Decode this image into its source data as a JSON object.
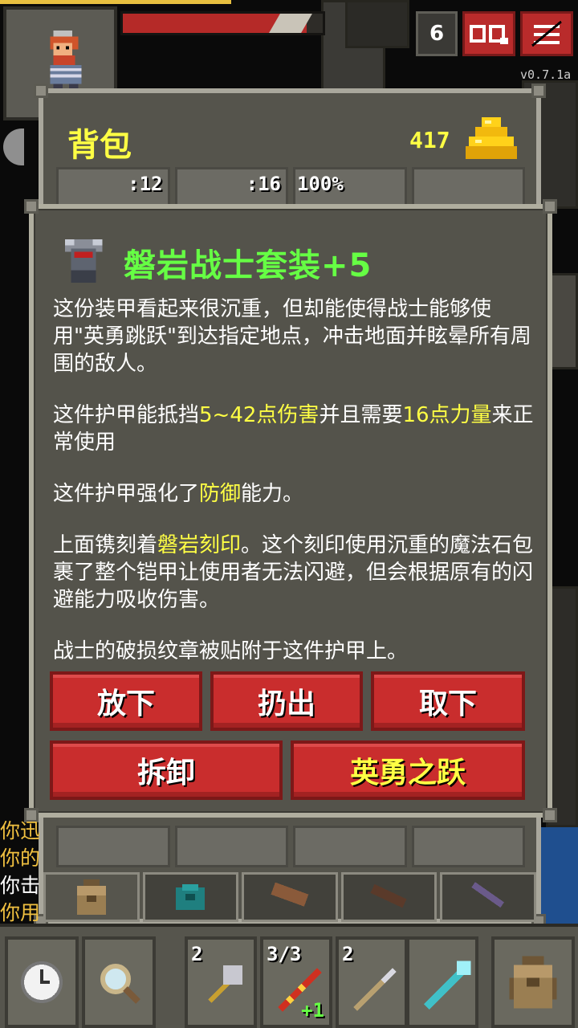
{
  "status": {
    "hp_fraction": 0.92,
    "xp_fraction": 0.4,
    "depth": "6",
    "version": "v0.7.1a"
  },
  "backpack": {
    "title": "背包",
    "gold": "417",
    "slot_labels": [
      ":12",
      ":16",
      "100%"
    ]
  },
  "item": {
    "name": "磐岩战士套装+5",
    "paragraphs": [
      [
        {
          "t": "这份装甲看起来很沉重，但却能使得战士能够使用\"英勇跳跃\"到达指定地点，冲击地面并眩晕所有周围的敌人。"
        }
      ],
      [
        {
          "t": "这件护甲能抵挡"
        },
        {
          "t": "5~42点伤害",
          "hl": true
        },
        {
          "t": "并且需要"
        },
        {
          "t": "16点力量",
          "hl": true
        },
        {
          "t": "来正常使用"
        }
      ],
      [
        {
          "t": "这件护甲强化了"
        },
        {
          "t": "防御",
          "hl": true
        },
        {
          "t": "能力。"
        }
      ],
      [
        {
          "t": "上面镌刻着"
        },
        {
          "t": "磐岩刻印",
          "hl": true
        },
        {
          "t": "。这个刻印使用沉重的魔法石包裹了整个铠甲让使用者无法闪避，但会根据原有的闪避能力吸收伤害。"
        }
      ],
      [
        {
          "t": "战士的破损纹章被贴附于这件护甲上。"
        }
      ]
    ],
    "actions": {
      "drop": "放下",
      "throw": "扔出",
      "unequip": "取下",
      "detach": "拆卸",
      "heroic_leap": "英勇之跃"
    }
  },
  "log": [
    "你迅",
    "你的",
    "你击",
    "你用"
  ],
  "quickslots": [
    {
      "count": "2",
      "plus": ""
    },
    {
      "count": "3/3",
      "plus": "+1"
    },
    {
      "count": "2",
      "plus": ""
    },
    {
      "count": "",
      "plus": ""
    }
  ]
}
